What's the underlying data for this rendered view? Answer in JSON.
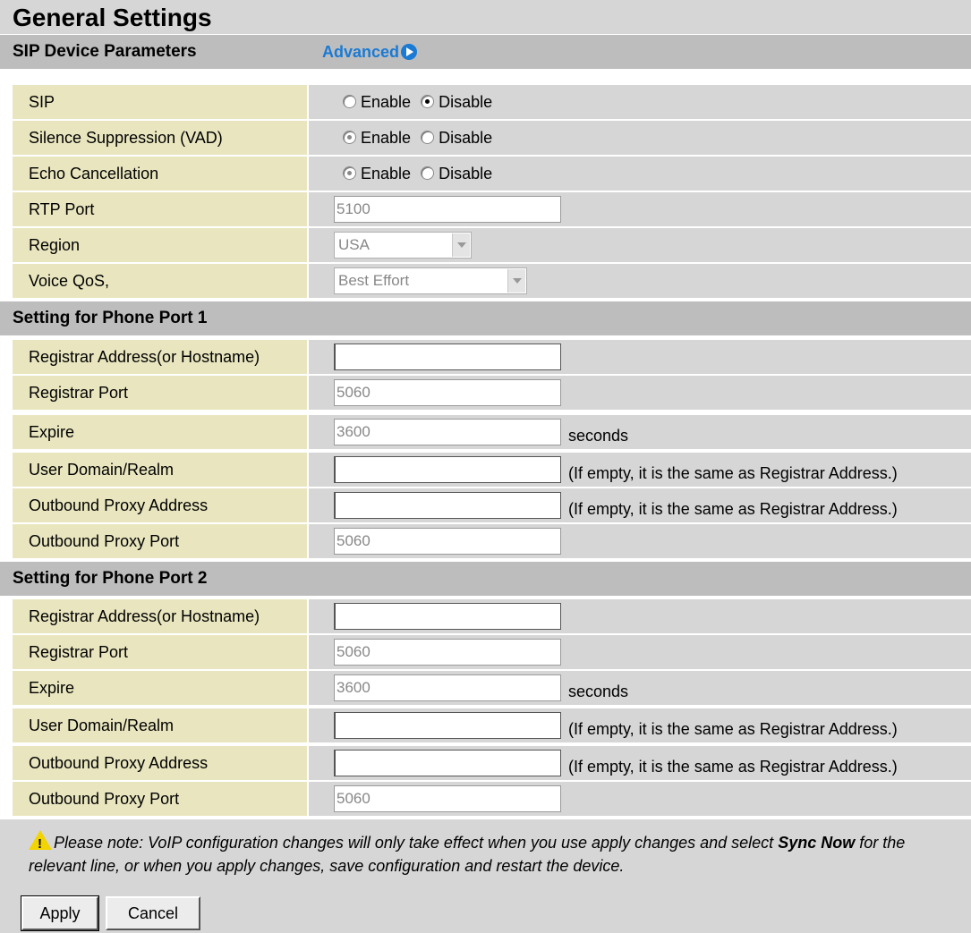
{
  "title": "General Settings",
  "sip_section": {
    "header": "SIP Device Parameters",
    "advanced_link": "Advanced",
    "rows": {
      "sip": {
        "label": "SIP",
        "enable": "Enable",
        "disable": "Disable",
        "selected": "Disable"
      },
      "vad": {
        "label": "Silence Suppression (VAD)",
        "enable": "Enable",
        "disable": "Disable",
        "selected": "Enable"
      },
      "echo": {
        "label": "Echo Cancellation",
        "enable": "Enable",
        "disable": "Disable",
        "selected": "Enable"
      },
      "rtp_port": {
        "label": "RTP Port",
        "value": "5100"
      },
      "region": {
        "label": "Region",
        "value": "USA"
      },
      "voice_qos": {
        "label": "Voice QoS,",
        "value": "Best Effort"
      }
    }
  },
  "port1": {
    "header": "Setting for Phone Port 1",
    "registrar_address": {
      "label": "Registrar Address(or Hostname)",
      "value": ""
    },
    "registrar_port": {
      "label": "Registrar Port",
      "value": "5060"
    },
    "expire": {
      "label": "Expire",
      "value": "3600",
      "suffix": "seconds"
    },
    "user_domain": {
      "label": "User Domain/Realm",
      "value": "",
      "suffix": "(If empty, it is the same as Registrar Address.)"
    },
    "outbound_proxy_address": {
      "label": "Outbound Proxy Address",
      "value": "",
      "suffix": "(If empty, it is the same as Registrar Address.)"
    },
    "outbound_proxy_port": {
      "label": "Outbound Proxy Port",
      "value": "5060"
    }
  },
  "port2": {
    "header": "Setting for Phone Port 2",
    "registrar_address": {
      "label": "Registrar Address(or Hostname)",
      "value": ""
    },
    "registrar_port": {
      "label": "Registrar Port",
      "value": "5060"
    },
    "expire": {
      "label": "Expire",
      "value": "3600",
      "suffix": "seconds"
    },
    "user_domain": {
      "label": "User Domain/Realm",
      "value": "",
      "suffix": "(If empty, it is the same as Registrar Address.)"
    },
    "outbound_proxy_address": {
      "label": "Outbound Proxy Address",
      "value": "",
      "suffix": "(If empty, it is the same as Registrar Address.)"
    },
    "outbound_proxy_port": {
      "label": "Outbound Proxy Port",
      "value": "5060"
    }
  },
  "note": {
    "icon": "warning-icon",
    "text_before": "Please note: VoIP configuration changes will only take effect when you use apply changes and select ",
    "bold": "Sync Now",
    "text_after": " for the relevant line, or when you apply changes, save configuration and restart the device."
  },
  "buttons": {
    "apply": "Apply",
    "cancel": "Cancel"
  },
  "colors": {
    "label_bg": "#e9e6bf",
    "value_bg": "#d6d6d6",
    "header_bg": "#bdbdbd",
    "link": "#1a7ad4"
  }
}
